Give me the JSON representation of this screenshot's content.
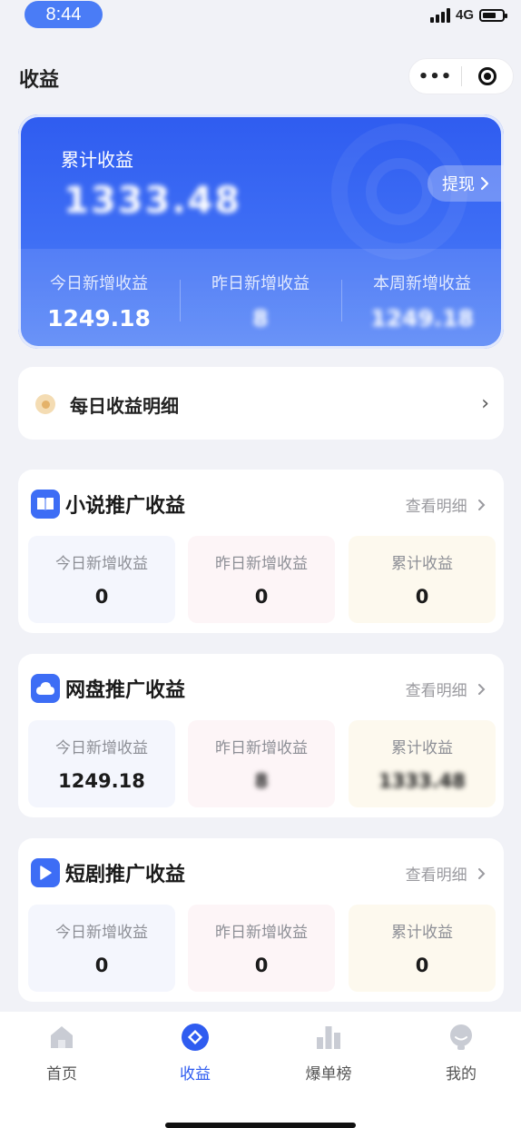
{
  "status_bar": {
    "time": "8:44",
    "network": "4G",
    "battery_level": 0.7
  },
  "header": {
    "title": "收益",
    "more_glyph": "•••"
  },
  "summary": {
    "label": "累计收益",
    "value": "1333.48",
    "withdraw_label": "提现",
    "columns": [
      {
        "label": "今日新增收益",
        "value": "1249.18",
        "blurred": false
      },
      {
        "label": "昨日新增收益",
        "value": "8",
        "blurred": true
      },
      {
        "label": "本周新增收益",
        "value": "1249.18",
        "blurred": true
      }
    ]
  },
  "daily": {
    "label": "每日收益明细",
    "chevron": "›"
  },
  "detail_link": "查看明细",
  "sections": [
    {
      "title": "小说推广收益",
      "icon": "book-icon",
      "stats": [
        {
          "label": "今日新增收益",
          "value": "0",
          "blurred": false
        },
        {
          "label": "昨日新增收益",
          "value": "0",
          "blurred": false
        },
        {
          "label": "累计收益",
          "value": "0",
          "blurred": false
        }
      ]
    },
    {
      "title": "网盘推广收益",
      "icon": "cloud-icon",
      "stats": [
        {
          "label": "今日新增收益",
          "value": "1249.18",
          "blurred": false
        },
        {
          "label": "昨日新增收益",
          "value": "8",
          "blurred": true
        },
        {
          "label": "累计收益",
          "value": "1333.48",
          "blurred": true
        }
      ]
    },
    {
      "title": "短剧推广收益",
      "icon": "play-icon",
      "stats": [
        {
          "label": "今日新增收益",
          "value": "0",
          "blurred": false
        },
        {
          "label": "昨日新增收益",
          "value": "0",
          "blurred": false
        },
        {
          "label": "累计收益",
          "value": "0",
          "blurred": false
        }
      ]
    }
  ],
  "tabbar": [
    {
      "label": "首页",
      "icon": "home-icon",
      "active": false
    },
    {
      "label": "收益",
      "icon": "earnings-icon",
      "active": true
    },
    {
      "label": "爆单榜",
      "icon": "ranking-icon",
      "active": false
    },
    {
      "label": "我的",
      "icon": "profile-icon",
      "active": false
    }
  ],
  "colors": {
    "accent": "#2f5cf0",
    "background": "#f1f2f7"
  }
}
